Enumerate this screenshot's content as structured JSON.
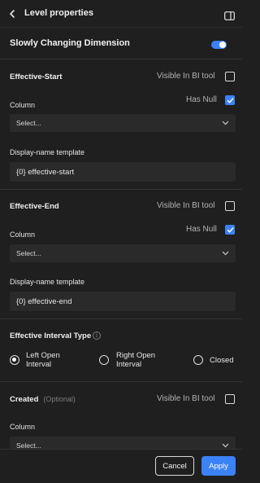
{
  "header": {
    "title": "Level properties",
    "back_icon": "chevron-left-icon",
    "panel_icon": "panel-toggle-icon"
  },
  "scd": {
    "label": "Slowly Changing Dimension",
    "enabled": true
  },
  "effective_start": {
    "title": "Effective-Start",
    "visible_label": "Visible In BI tool",
    "visible_checked": false,
    "column_label": "Column",
    "has_null_label": "Has Null",
    "has_null_checked": true,
    "select_placeholder": "Select...",
    "display_name_label": "Display-name template",
    "display_name_value": "{0} effective-start"
  },
  "effective_end": {
    "title": "Effective-End",
    "visible_label": "Visible In BI tool",
    "visible_checked": false,
    "column_label": "Column",
    "has_null_label": "Has Null",
    "has_null_checked": true,
    "select_placeholder": "Select...",
    "display_name_label": "Display-name template",
    "display_name_value": "{0} effective-end"
  },
  "interval": {
    "title": "Effective Interval Type",
    "options": [
      {
        "line1": "Left Open",
        "line2": "Interval",
        "selected": true
      },
      {
        "line1": "Right Open",
        "line2": "Interval",
        "selected": false
      },
      {
        "line1": "Closed",
        "line2": "",
        "selected": false
      }
    ]
  },
  "created": {
    "title": "Created",
    "optional": "(Optional)",
    "visible_label": "Visible In BI tool",
    "visible_checked": false,
    "column_label": "Column",
    "select_placeholder": "Select..."
  },
  "footer": {
    "cancel": "Cancel",
    "apply": "Apply"
  },
  "colors": {
    "accent": "#3b82f6",
    "background": "#1f1f1f",
    "field": "#2a2a2a"
  }
}
